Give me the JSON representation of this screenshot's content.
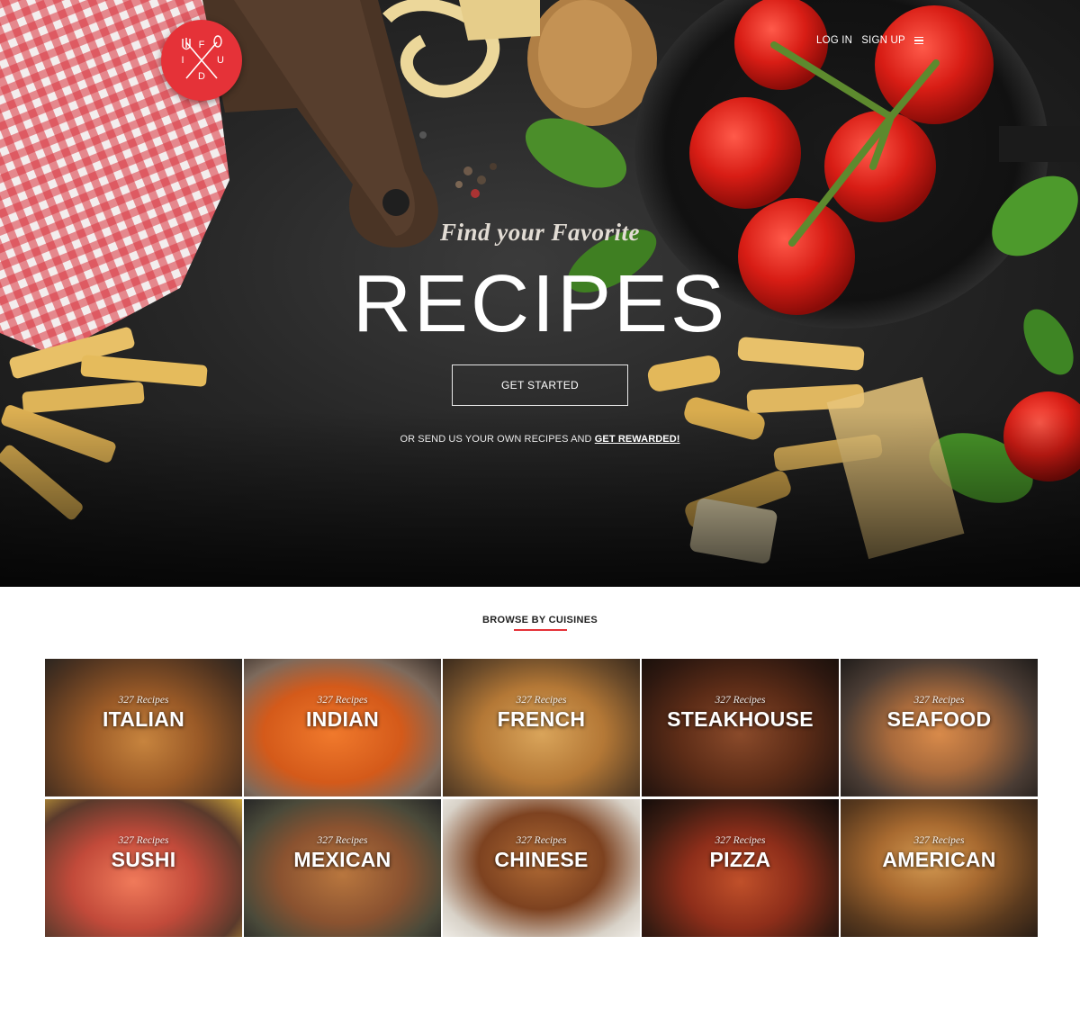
{
  "brand": {
    "logo_letters": [
      "F",
      "U",
      "D",
      "I"
    ],
    "accent_color": "#e53238"
  },
  "nav": {
    "login": "LOG IN",
    "signup": "SIGN UP",
    "menu_icon": "hamburger-menu-icon"
  },
  "hero": {
    "tagline": "Find your Favorite",
    "title": "RECIPES",
    "cta_label": "GET STARTED",
    "sub_text": "OR SEND US YOUR OWN RECIPES AND ",
    "sub_link": "GET REWARDED!"
  },
  "browse": {
    "title": "BROWSE BY CUISINES",
    "cuisines": [
      {
        "name": "ITALIAN",
        "count": "327 Recipes"
      },
      {
        "name": "INDIAN",
        "count": "327 Recipes"
      },
      {
        "name": "FRENCH",
        "count": "327 Recipes"
      },
      {
        "name": "STEAKHOUSE",
        "count": "327 Recipes"
      },
      {
        "name": "SEAFOOD",
        "count": "327 Recipes"
      },
      {
        "name": "SUSHI",
        "count": "327 Recipes"
      },
      {
        "name": "MEXICAN",
        "count": "327 Recipes"
      },
      {
        "name": "CHINESE",
        "count": "327 Recipes"
      },
      {
        "name": "PIZZA",
        "count": "327 Recipes"
      },
      {
        "name": "AMERICAN",
        "count": "327 Recipes"
      }
    ]
  }
}
